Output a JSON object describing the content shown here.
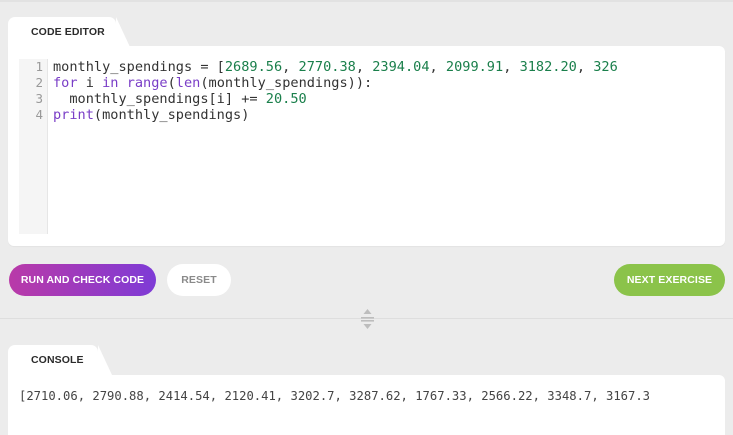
{
  "editor": {
    "tab_label": "CODE EDITOR",
    "line_numbers": [
      "1",
      "2",
      "3",
      "4"
    ],
    "lines": [
      [
        {
          "t": "monthly_spendings = [",
          "c": ""
        },
        {
          "t": "2689.56",
          "c": "num"
        },
        {
          "t": ", ",
          "c": ""
        },
        {
          "t": "2770.38",
          "c": "num"
        },
        {
          "t": ", ",
          "c": ""
        },
        {
          "t": "2394.04",
          "c": "num"
        },
        {
          "t": ", ",
          "c": ""
        },
        {
          "t": "2099.91",
          "c": "num"
        },
        {
          "t": ", ",
          "c": ""
        },
        {
          "t": "3182.20",
          "c": "num"
        },
        {
          "t": ", ",
          "c": ""
        },
        {
          "t": "326",
          "c": "num"
        }
      ],
      [
        {
          "t": "for",
          "c": "kw"
        },
        {
          "t": " i ",
          "c": ""
        },
        {
          "t": "in",
          "c": "kw"
        },
        {
          "t": " ",
          "c": ""
        },
        {
          "t": "range",
          "c": "kw"
        },
        {
          "t": "(",
          "c": ""
        },
        {
          "t": "len",
          "c": "kw"
        },
        {
          "t": "(monthly_spendings)):",
          "c": ""
        }
      ],
      [
        {
          "t": "  monthly_spendings[i] += ",
          "c": ""
        },
        {
          "t": "20.50",
          "c": "num"
        }
      ],
      [
        {
          "t": "print",
          "c": "kw"
        },
        {
          "t": "(monthly_spendings)",
          "c": ""
        }
      ]
    ]
  },
  "buttons": {
    "run_label": "RUN AND CHECK CODE",
    "reset_label": "RESET",
    "next_label": "NEXT EXERCISE"
  },
  "console": {
    "tab_label": "CONSOLE",
    "output": "[2710.06, 2790.88, 2414.54, 2120.41, 3202.7, 3287.62, 1767.33, 2566.22, 3348.7, 3167.3"
  },
  "colors": {
    "run_gradient_start": "#b93aa8",
    "run_gradient_end": "#7e3bd6",
    "next_button": "#8bc34a",
    "keyword": "#7a3ec7",
    "number": "#1a7f4b"
  },
  "icons": {
    "resize_handle": "resize-vertical-icon"
  }
}
